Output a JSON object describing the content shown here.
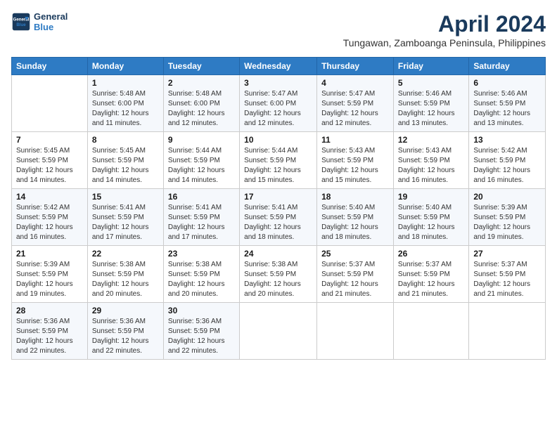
{
  "app": {
    "logo_line1": "General",
    "logo_line2": "Blue",
    "title": "April 2024",
    "subtitle": "Tungawan, Zamboanga Peninsula, Philippines"
  },
  "calendar": {
    "headers": [
      "Sunday",
      "Monday",
      "Tuesday",
      "Wednesday",
      "Thursday",
      "Friday",
      "Saturday"
    ],
    "weeks": [
      [
        {
          "day": "",
          "info": ""
        },
        {
          "day": "1",
          "info": "Sunrise: 5:48 AM\nSunset: 6:00 PM\nDaylight: 12 hours and 11 minutes."
        },
        {
          "day": "2",
          "info": "Sunrise: 5:48 AM\nSunset: 6:00 PM\nDaylight: 12 hours and 12 minutes."
        },
        {
          "day": "3",
          "info": "Sunrise: 5:47 AM\nSunset: 6:00 PM\nDaylight: 12 hours and 12 minutes."
        },
        {
          "day": "4",
          "info": "Sunrise: 5:47 AM\nSunset: 5:59 PM\nDaylight: 12 hours and 12 minutes."
        },
        {
          "day": "5",
          "info": "Sunrise: 5:46 AM\nSunset: 5:59 PM\nDaylight: 12 hours and 13 minutes."
        },
        {
          "day": "6",
          "info": "Sunrise: 5:46 AM\nSunset: 5:59 PM\nDaylight: 12 hours and 13 minutes."
        }
      ],
      [
        {
          "day": "7",
          "info": "Sunrise: 5:45 AM\nSunset: 5:59 PM\nDaylight: 12 hours and 14 minutes."
        },
        {
          "day": "8",
          "info": "Sunrise: 5:45 AM\nSunset: 5:59 PM\nDaylight: 12 hours and 14 minutes."
        },
        {
          "day": "9",
          "info": "Sunrise: 5:44 AM\nSunset: 5:59 PM\nDaylight: 12 hours and 14 minutes."
        },
        {
          "day": "10",
          "info": "Sunrise: 5:44 AM\nSunset: 5:59 PM\nDaylight: 12 hours and 15 minutes."
        },
        {
          "day": "11",
          "info": "Sunrise: 5:43 AM\nSunset: 5:59 PM\nDaylight: 12 hours and 15 minutes."
        },
        {
          "day": "12",
          "info": "Sunrise: 5:43 AM\nSunset: 5:59 PM\nDaylight: 12 hours and 16 minutes."
        },
        {
          "day": "13",
          "info": "Sunrise: 5:42 AM\nSunset: 5:59 PM\nDaylight: 12 hours and 16 minutes."
        }
      ],
      [
        {
          "day": "14",
          "info": "Sunrise: 5:42 AM\nSunset: 5:59 PM\nDaylight: 12 hours and 16 minutes."
        },
        {
          "day": "15",
          "info": "Sunrise: 5:41 AM\nSunset: 5:59 PM\nDaylight: 12 hours and 17 minutes."
        },
        {
          "day": "16",
          "info": "Sunrise: 5:41 AM\nSunset: 5:59 PM\nDaylight: 12 hours and 17 minutes."
        },
        {
          "day": "17",
          "info": "Sunrise: 5:41 AM\nSunset: 5:59 PM\nDaylight: 12 hours and 18 minutes."
        },
        {
          "day": "18",
          "info": "Sunrise: 5:40 AM\nSunset: 5:59 PM\nDaylight: 12 hours and 18 minutes."
        },
        {
          "day": "19",
          "info": "Sunrise: 5:40 AM\nSunset: 5:59 PM\nDaylight: 12 hours and 18 minutes."
        },
        {
          "day": "20",
          "info": "Sunrise: 5:39 AM\nSunset: 5:59 PM\nDaylight: 12 hours and 19 minutes."
        }
      ],
      [
        {
          "day": "21",
          "info": "Sunrise: 5:39 AM\nSunset: 5:59 PM\nDaylight: 12 hours and 19 minutes."
        },
        {
          "day": "22",
          "info": "Sunrise: 5:38 AM\nSunset: 5:59 PM\nDaylight: 12 hours and 20 minutes."
        },
        {
          "day": "23",
          "info": "Sunrise: 5:38 AM\nSunset: 5:59 PM\nDaylight: 12 hours and 20 minutes."
        },
        {
          "day": "24",
          "info": "Sunrise: 5:38 AM\nSunset: 5:59 PM\nDaylight: 12 hours and 20 minutes."
        },
        {
          "day": "25",
          "info": "Sunrise: 5:37 AM\nSunset: 5:59 PM\nDaylight: 12 hours and 21 minutes."
        },
        {
          "day": "26",
          "info": "Sunrise: 5:37 AM\nSunset: 5:59 PM\nDaylight: 12 hours and 21 minutes."
        },
        {
          "day": "27",
          "info": "Sunrise: 5:37 AM\nSunset: 5:59 PM\nDaylight: 12 hours and 21 minutes."
        }
      ],
      [
        {
          "day": "28",
          "info": "Sunrise: 5:36 AM\nSunset: 5:59 PM\nDaylight: 12 hours and 22 minutes."
        },
        {
          "day": "29",
          "info": "Sunrise: 5:36 AM\nSunset: 5:59 PM\nDaylight: 12 hours and 22 minutes."
        },
        {
          "day": "30",
          "info": "Sunrise: 5:36 AM\nSunset: 5:59 PM\nDaylight: 12 hours and 22 minutes."
        },
        {
          "day": "",
          "info": ""
        },
        {
          "day": "",
          "info": ""
        },
        {
          "day": "",
          "info": ""
        },
        {
          "day": "",
          "info": ""
        }
      ]
    ]
  }
}
